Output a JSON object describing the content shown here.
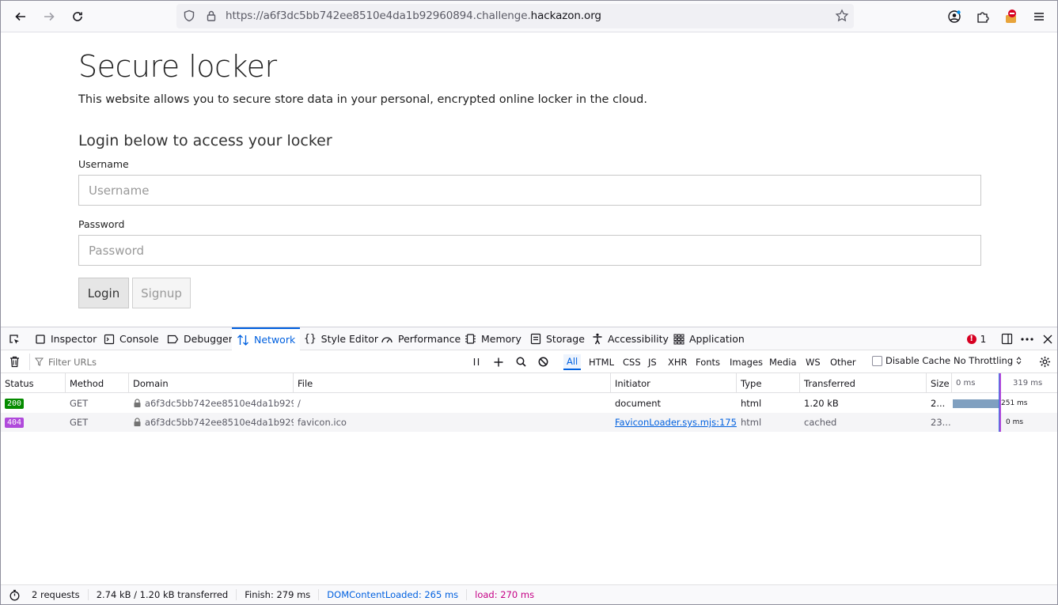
{
  "browser": {
    "url_prefix": "https://a6f3dc5bb742ee8510e4da1b92960894.challenge.",
    "url_domain": "hackazon.org"
  },
  "page": {
    "title": "Secure locker",
    "lead": "This website allows you to secure store data in your personal, encrypted online locker in the cloud.",
    "subtitle": "Login below to access your locker",
    "username_label": "Username",
    "username_placeholder": "Username",
    "password_label": "Password",
    "password_placeholder": "Password",
    "login_label": "Login",
    "signup_label": "Signup"
  },
  "devtools": {
    "tabs": {
      "inspector": "Inspector",
      "console": "Console",
      "debugger": "Debugger",
      "network": "Network",
      "style_editor": "Style Editor",
      "performance": "Performance",
      "memory": "Memory",
      "storage": "Storage",
      "accessibility": "Accessibility",
      "application": "Application"
    },
    "error_count": "1",
    "filter_placeholder": "Filter URLs",
    "type_filters": {
      "all": "All",
      "html": "HTML",
      "css": "CSS",
      "js": "JS",
      "xhr": "XHR",
      "fonts": "Fonts",
      "images": "Images",
      "media": "Media",
      "ws": "WS",
      "other": "Other"
    },
    "disable_cache": "Disable Cache",
    "throttling": "No Throttling",
    "columns": {
      "status": "Status",
      "method": "Method",
      "domain": "Domain",
      "file": "File",
      "initiator": "Initiator",
      "type": "Type",
      "transferred": "Transferred",
      "size": "Size",
      "wf_start": "0 ms",
      "wf_end": "319 ms"
    },
    "requests": [
      {
        "status": "200",
        "method": "GET",
        "domain": "a6f3dc5bb742ee8510e4da1b9296...",
        "file": "/",
        "initiator": "document",
        "type": "html",
        "transferred": "1.20 kB",
        "size": "2...",
        "timing": "251 ms",
        "status_color": "#058b00"
      },
      {
        "status": "404",
        "method": "GET",
        "domain": "a6f3dc5bb742ee8510e4da1b9296...",
        "file": "favicon.ico",
        "initiator_link": "FaviconLoader.sys.mjs:175",
        "initiator_rest": " (...",
        "type": "html",
        "transferred": "cached",
        "size": "23...",
        "timing": "0 ms",
        "status_color": "#b04adb"
      }
    ],
    "statusbar": {
      "requests": "2 requests",
      "transferred": "2.74 kB / 1.20 kB transferred",
      "finish": "Finish: 279 ms",
      "dom_loaded": "DOMContentLoaded: 265 ms",
      "load": "load: 270 ms"
    }
  }
}
